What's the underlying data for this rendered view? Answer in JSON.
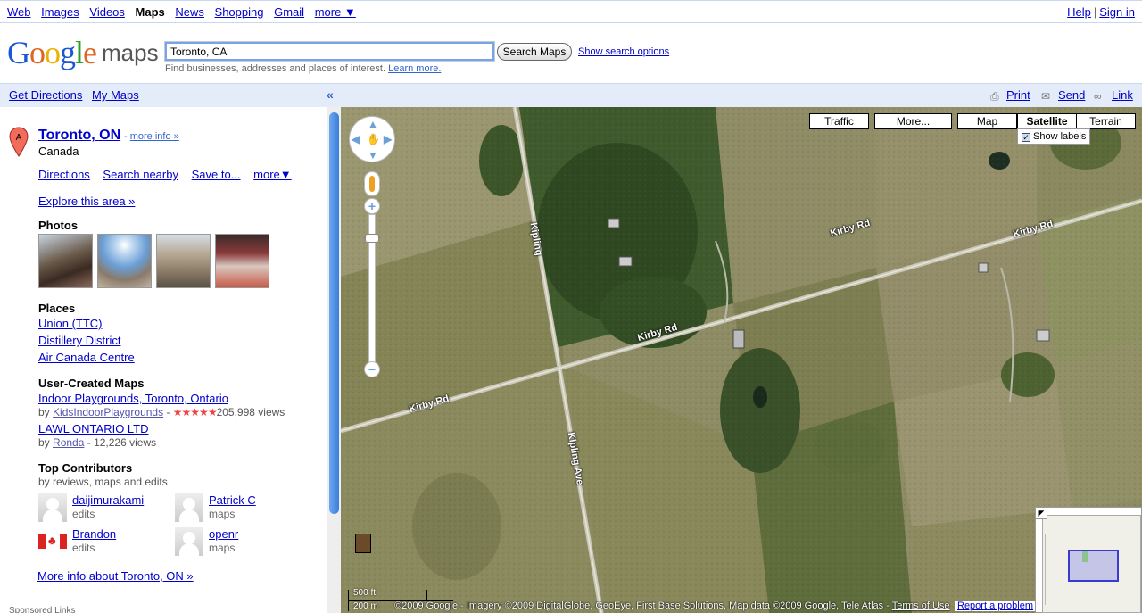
{
  "topnav": {
    "left": [
      "Web",
      "Images",
      "Videos",
      "Maps",
      "News",
      "Shopping",
      "Gmail",
      "more ▼"
    ],
    "current": "Maps",
    "help": "Help",
    "signin": "Sign in"
  },
  "header": {
    "logo_google": "Google",
    "logo_maps": "maps",
    "search_value": "Toronto, CA",
    "search_button": "Search Maps",
    "search_options": "Show search options",
    "hint": "Find businesses, addresses and places of interest.",
    "learn_more": "Learn more."
  },
  "leftbar": {
    "get_directions": "Get Directions",
    "my_maps": "My Maps",
    "collapse": "«"
  },
  "result": {
    "marker": "A",
    "title": "Toronto, ON",
    "more_info": "more info »",
    "country": "Canada",
    "actions": [
      "Directions",
      "Search nearby",
      "Save to...",
      "more▼"
    ],
    "explore": "Explore this area »",
    "photos_heading": "Photos",
    "places_heading": "Places",
    "places": [
      "Union (TTC)",
      "Distillery District",
      "Air Canada Centre"
    ],
    "user_maps_heading": "User-Created Maps",
    "user_maps": [
      {
        "title": "Indoor Playgrounds, Toronto, Ontario",
        "by": "by",
        "author": "KidsIndoorPlaygrounds",
        "rating_stars": "★★★★★",
        "views": "205,998 views",
        "rating": 5
      },
      {
        "title": "LAWL ONTARIO LTD",
        "by": "by",
        "author": "Ronda",
        "views": "- 12,226 views"
      }
    ],
    "contributors_heading": "Top Contributors",
    "contributors_sub": "by reviews, maps and edits",
    "contributors": [
      {
        "name": "daijimurakami",
        "role": "edits"
      },
      {
        "name": "Patrick C",
        "role": "maps"
      },
      {
        "name": "Brandon",
        "role": "edits"
      },
      {
        "name": "openr",
        "role": "maps"
      }
    ],
    "more_info_link": "More info about Toronto, ON »",
    "sponsored": "Sponsored Links"
  },
  "mapbar": {
    "print": "Print",
    "send": "Send",
    "link": "Link"
  },
  "map": {
    "buttons": {
      "traffic": "Traffic",
      "more": "More...",
      "map": "Map",
      "satellite": "Satellite",
      "terrain": "Terrain"
    },
    "selected_type": "Satellite",
    "show_labels": "Show labels",
    "show_labels_checked": true,
    "roads": {
      "kirby1": "Kirby Rd",
      "kirby2": "Kirby Rd",
      "kirby3": "Kirby Rd",
      "kirby4": "Kirby Rd",
      "kipling": "Kipling",
      "kipling_ave": "Kipling Ave"
    },
    "scale_ft": "500 ft",
    "scale_m": "200 m",
    "copyright": "©2009 Google - Imagery ©2009 DigitalGlobe, GeoEye, First Base Solutions, Map data ©2009 Google, Tele Atlas -",
    "terms": "Terms of Use",
    "report": "Report a problem"
  },
  "colors": {
    "link": "#0000cc",
    "bar_bg": "#e5ecf9",
    "satellite_base": "#8c8a62"
  }
}
